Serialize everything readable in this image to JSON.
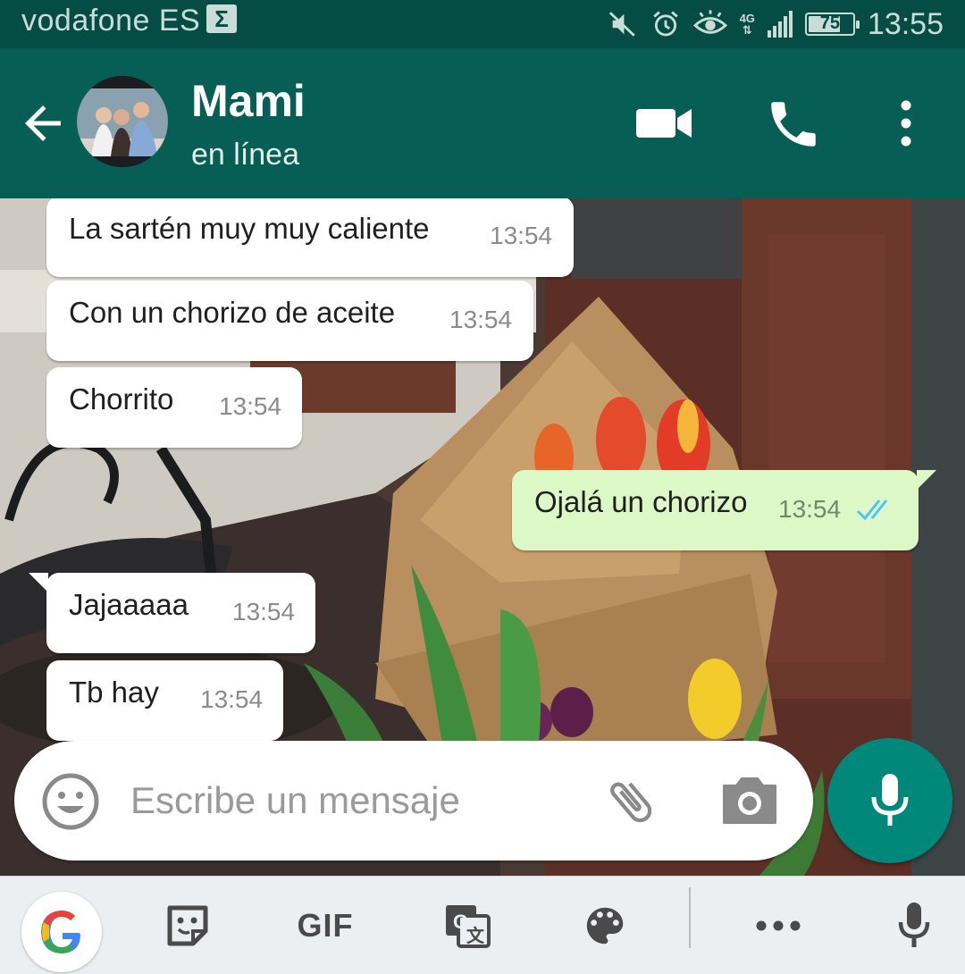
{
  "status_bar": {
    "carrier": "vodafone ES",
    "carrier_badge": "Σ",
    "network_type": "4G",
    "battery_level": "75",
    "battery_fraction": 0.75,
    "time": "13:55",
    "icons": [
      "mute-icon",
      "alarm-icon",
      "eye-comfort-icon",
      "signal-icon",
      "battery-icon"
    ]
  },
  "header": {
    "contact_name": "Mami",
    "contact_status": "en línea",
    "icons": [
      "back-arrow-icon",
      "video-call-icon",
      "phone-icon",
      "more-vert-icon"
    ]
  },
  "theme": {
    "header_color": "#075e54",
    "status_bar_color": "#054d44",
    "incoming_bubble": "#ffffff",
    "outgoing_bubble": "#dcf8c6",
    "read_tick_color": "#4fc3f7",
    "fab_color": "#00897b"
  },
  "messages": [
    {
      "direction": "in",
      "text": "La sartén muy muy caliente",
      "time": "13:54"
    },
    {
      "direction": "in",
      "text": "Con un chorizo de aceite",
      "time": "13:54"
    },
    {
      "direction": "in",
      "text": "Chorrito",
      "time": "13:54"
    },
    {
      "direction": "out",
      "text": "Ojalá un chorizo",
      "time": "13:54",
      "status": "read"
    },
    {
      "direction": "in",
      "text": "Jajaaaaa",
      "time": "13:54"
    },
    {
      "direction": "in",
      "text": "Tb hay",
      "time": "13:54"
    }
  ],
  "composer": {
    "placeholder": "Escribe un mensaje",
    "value": "",
    "icons": [
      "emoji-icon",
      "paperclip-icon",
      "camera-icon",
      "mic-icon"
    ]
  },
  "keyboard_toolbar": {
    "gif_label": "GIF",
    "icons": [
      "google-icon",
      "sticker-icon",
      "translate-icon",
      "palette-icon",
      "more-horiz-icon",
      "voice-input-icon"
    ]
  }
}
